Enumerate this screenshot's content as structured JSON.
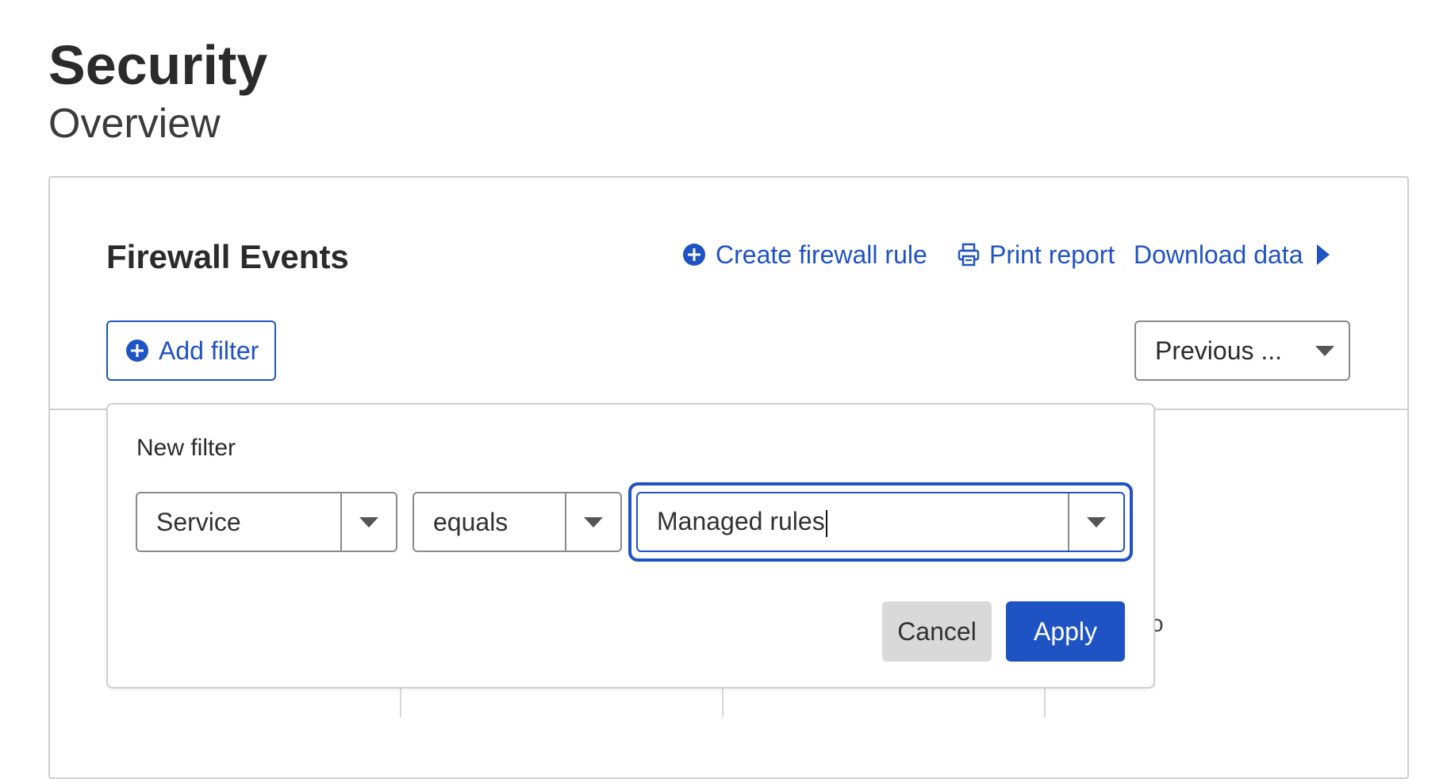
{
  "page": {
    "title": "Security",
    "subtitle": "Overview"
  },
  "card": {
    "title": "Firewall Events",
    "actions": {
      "create_rule": "Create firewall rule",
      "print_report": "Print report",
      "download_data": "Download data"
    },
    "add_filter_label": "Add filter",
    "time_range_selected": "Previous ...",
    "partial_text": "o"
  },
  "filter_popover": {
    "title": "New filter",
    "field": {
      "selected": "Service"
    },
    "operator": {
      "selected": "equals"
    },
    "value": {
      "current": "Managed rules"
    },
    "cancel_label": "Cancel",
    "apply_label": "Apply"
  },
  "colors": {
    "accent": "#1f53c4",
    "border": "#cfcfcf",
    "cancel_bg": "#d9d9d9"
  },
  "icons": {
    "create_rule": "plus-circle-icon",
    "print_report": "printer-icon",
    "download_data": "caret-right-icon",
    "add_filter": "plus-circle-icon",
    "dropdown": "chevron-down-icon"
  }
}
